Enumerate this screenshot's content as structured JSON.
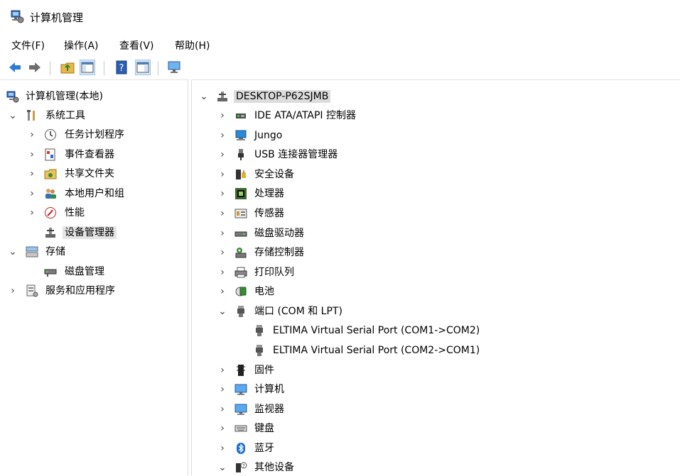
{
  "window": {
    "title": "计算机管理"
  },
  "menu": [
    "文件(F)",
    "操作(A)",
    "查看(V)",
    "帮助(H)"
  ],
  "toolbar": {
    "buttons": [
      {
        "name": "back-button",
        "icon": "arrow-left-icon"
      },
      {
        "name": "forward-button",
        "icon": "arrow-right-icon"
      },
      {
        "name": "up-folder-button",
        "icon": "folder-up-icon"
      },
      {
        "name": "show-hide-tree-button",
        "icon": "console-tree-icon",
        "selected": true
      },
      {
        "name": "help-button",
        "icon": "help-icon"
      },
      {
        "name": "action-pane-button",
        "icon": "action-pane-icon",
        "selected": true
      },
      {
        "name": "monitor-button",
        "icon": "monitor-icon"
      }
    ]
  },
  "left_tree": [
    {
      "label": "计算机管理(本地)",
      "icon": "computer-manage-icon",
      "level": 0,
      "expander": "none"
    },
    {
      "label": "系统工具",
      "icon": "tools-icon",
      "level": 1,
      "expander": "expanded"
    },
    {
      "label": "任务计划程序",
      "icon": "clock-icon",
      "level": 2,
      "expander": "collapsed"
    },
    {
      "label": "事件查看器",
      "icon": "event-viewer-icon",
      "level": 2,
      "expander": "collapsed"
    },
    {
      "label": "共享文件夹",
      "icon": "shared-folder-icon",
      "level": 2,
      "expander": "collapsed"
    },
    {
      "label": "本地用户和组",
      "icon": "users-icon",
      "level": 2,
      "expander": "collapsed"
    },
    {
      "label": "性能",
      "icon": "performance-icon",
      "level": 2,
      "expander": "collapsed"
    },
    {
      "label": "设备管理器",
      "icon": "device-manager-icon",
      "level": 2,
      "expander": "none",
      "selected": true
    },
    {
      "label": "存储",
      "icon": "storage-icon",
      "level": 1,
      "expander": "expanded"
    },
    {
      "label": "磁盘管理",
      "icon": "disk-management-icon",
      "level": 2,
      "expander": "none"
    },
    {
      "label": "服务和应用程序",
      "icon": "services-icon",
      "level": 1,
      "expander": "collapsed"
    }
  ],
  "device_tree": [
    {
      "label": "DESKTOP-P62SJMB",
      "icon": "network-computer-icon",
      "level": 0,
      "expander": "expanded",
      "selected": true
    },
    {
      "label": "IDE ATA/ATAPI 控制器",
      "icon": "ide-controller-icon",
      "level": 1,
      "expander": "collapsed"
    },
    {
      "label": "Jungo",
      "icon": "jungo-icon",
      "level": 1,
      "expander": "collapsed"
    },
    {
      "label": "USB 连接器管理器",
      "icon": "usb-icon",
      "level": 1,
      "expander": "collapsed"
    },
    {
      "label": "安全设备",
      "icon": "security-device-icon",
      "level": 1,
      "expander": "collapsed"
    },
    {
      "label": "处理器",
      "icon": "processor-icon",
      "level": 1,
      "expander": "collapsed"
    },
    {
      "label": "传感器",
      "icon": "sensor-icon",
      "level": 1,
      "expander": "collapsed"
    },
    {
      "label": "磁盘驱动器",
      "icon": "disk-drive-icon",
      "level": 1,
      "expander": "collapsed"
    },
    {
      "label": "存储控制器",
      "icon": "storage-controller-icon",
      "level": 1,
      "expander": "collapsed"
    },
    {
      "label": "打印队列",
      "icon": "printer-icon",
      "level": 1,
      "expander": "collapsed"
    },
    {
      "label": "电池",
      "icon": "battery-icon",
      "level": 1,
      "expander": "collapsed"
    },
    {
      "label": "端口 (COM 和 LPT)",
      "icon": "port-icon",
      "level": 1,
      "expander": "expanded"
    },
    {
      "label": "ELTIMA Virtual Serial Port (COM1->COM2)",
      "icon": "port-icon",
      "level": 2,
      "expander": "none"
    },
    {
      "label": "ELTIMA Virtual Serial Port (COM2->COM1)",
      "icon": "port-icon",
      "level": 2,
      "expander": "none"
    },
    {
      "label": "固件",
      "icon": "firmware-icon",
      "level": 1,
      "expander": "collapsed"
    },
    {
      "label": "计算机",
      "icon": "computer-icon",
      "level": 1,
      "expander": "collapsed"
    },
    {
      "label": "监视器",
      "icon": "monitor-icon",
      "level": 1,
      "expander": "collapsed"
    },
    {
      "label": "键盘",
      "icon": "keyboard-icon",
      "level": 1,
      "expander": "collapsed"
    },
    {
      "label": "蓝牙",
      "icon": "bluetooth-icon",
      "level": 1,
      "expander": "collapsed"
    },
    {
      "label": "其他设备",
      "icon": "other-devices-icon",
      "level": 1,
      "expander": "expanded"
    }
  ]
}
